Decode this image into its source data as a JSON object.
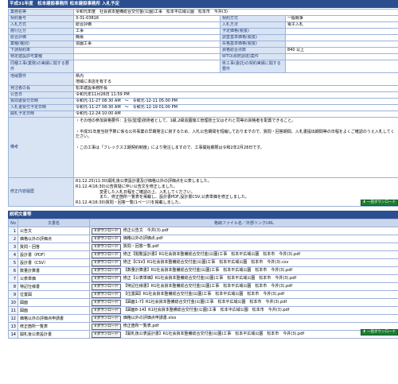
{
  "header": {
    "title": "平成31年度　松本建設事務所  松本建設事務所  入札予定"
  },
  "info": {
    "rows": [
      {
        "l1": "業務名等",
        "v1": "令和元年度　社会資本整備総合交付金(公園)工事　松本平広域公園　松本市　今井(3)",
        "span": true
      },
      {
        "l1": "契約番号",
        "v1": "3-31-03816",
        "l2": "契約方式",
        "v2": "一般競争"
      },
      {
        "l1": "入札方式",
        "v1": "総合評価",
        "l2": "入札方法",
        "v2": "電子入札"
      },
      {
        "l1": "施行区分",
        "v1": "工事",
        "l2": "予定価格(税抜)",
        "v2": ""
      },
      {
        "l1": "総合評価",
        "v1": "簡易",
        "l2": "調査基準価格(税抜)",
        "v2": ""
      },
      {
        "l1": "業種(種別)",
        "v1": "造園工事",
        "l2": "失格基準価格(税抜)",
        "v2": ""
      },
      {
        "l1": "下請契約率",
        "v1": "",
        "l2": "資格総合点数",
        "v2": "840 以上"
      },
      {
        "l1": "特定建設許可業種",
        "v1": "",
        "l2": "WTO(政府調達)案件",
        "v2": ""
      },
      {
        "l1": "同種工事(業務)の実績に関する要件",
        "v1": "",
        "l2": "県工事(委託)の契約実績に関する要件",
        "v2": "",
        "tall": true
      },
      {
        "l1": "地域要件",
        "v1": "県内\n地域に本店を有する",
        "span": true,
        "tall": true
      },
      {
        "l1": "発注者の長",
        "v1": "松本建設事務所長",
        "span": true
      },
      {
        "l1": "公告日",
        "v1": "令和元年11月26日 11:59 PM",
        "span": true
      },
      {
        "l1": "質問書受付日時",
        "v1": "令和元-11-27 08:30 AM　～　令和元-12-11 05:00 PM",
        "span": true
      },
      {
        "l1": "入札書受付予定日時",
        "v1": "令和元-11-27 08:30 AM　～　令和元-12-19 01:00 PM",
        "span": true
      },
      {
        "l1": "開札予定日時",
        "v1": "令和元-12-24 10:00 AM",
        "span": true
      }
    ],
    "remarks_label": "備考",
    "remarks": "・その他の参加資格要件：主任(監理)技術者として、1級,2級造園施工管理技士又はそれと同等の資格者を配置できること。\n\n・平成31年度当初予算に係る公共事業の早期発注に資するため、入札公告期間を短縮しておりますので、質問・回答期間、入札書提出期間等の日程をよくご確認のうえ入札してください。\n\n・この工事は「フレックス工期契約制度」により発注しますので、工事開始期限は令和2年2月28日です。",
    "history_label": "修正内容履歴",
    "history": "R1.12.25(11:30)開札後公表設計書及び価格以外の評価点を公表しました。\nR1.12.4(16:30)公告質疑に伴い公告文を修正しました。\n　　　　　　変更した入札日程をご確認の上、入札してください。\n　　　　　　また、修正箇所一覧表を掲載し、設計書PDF,設計書CSV,公表単価を修正しました。\nR1.12.4(16:30)質問・回答一覧(1ページ)を掲載しました。"
  },
  "all_download_label": "一括ダウンロード",
  "docs_section_title": "説明文書等",
  "docs": {
    "col_no": "No",
    "col_name": "文書名",
    "col_file": "格納ファイル名／外部リンクURL",
    "download_label": "ダウンロード",
    "rows": [
      {
        "no": "1",
        "name": "公告文",
        "file": "修正公告文　今井(3).pdf"
      },
      {
        "no": "2",
        "name": "価格以外の評価点",
        "file": "価格以外の評価点.pdf"
      },
      {
        "no": "3",
        "name": "質問・回答",
        "file": "質問・回答一覧.pdf"
      },
      {
        "no": "4",
        "name": "設計書（PDF）",
        "file": "修正【閲覧設計書】R1社会資本整備総合交付金(公園)工事　松本平広域公園　松本市　今井(3).pdf"
      },
      {
        "no": "5",
        "name": "設計書（CSV）",
        "file": "修正【CSV】R1社会資本整備総合交付金(公園)工事　松本平広域公園　松本市　今井(3).csv"
      },
      {
        "no": "6",
        "name": "数量計算書",
        "file": "【数量計算書】R1社会資本整備総合交付金(公園)工事　松本平広域公園　松本市　今井(3).pdf"
      },
      {
        "no": "7",
        "name": "公表単価",
        "file": "修正【公表単価】R1社会資本整備総合交付金(公園)工事　松本平広域公園　松本市　今井(3).pdf"
      },
      {
        "no": "8",
        "name": "特記仕様書",
        "file": "【特記仕様書】R1社会資本整備総合交付金(公園)工事　松本平広域公園　松本市　今井(3).pdf"
      },
      {
        "no": "9",
        "name": "位置図",
        "file": "【位置図】R1社会資本整備総合交付金(公園)工事　松本平広域公園　松本市　今井(3).pdf"
      },
      {
        "no": "10",
        "name": "図面",
        "file": "【図面1-7】R1社会資本整備総合交付金(公園)工事　松本平広域公園　松本市　今井(3).pdf"
      },
      {
        "no": "11",
        "name": "図面",
        "file": "【図面8-14】R1社会資本整備総合交付金(公園)工事　松本平広域公園　松本市　今井(3).pdf"
      },
      {
        "no": "12",
        "name": "価格以外の評価点申請書",
        "file": "価格以外の評価点申請書.xlsx"
      },
      {
        "no": "13",
        "name": "修正箇所一覧表",
        "file": "修正箇所一覧表.pdf"
      },
      {
        "no": "14",
        "name": "開札後公表設計書",
        "file": "【開札後公表設計書】R1社会資本整備総合交付金(公園)工事　松本平広域公園　松本市　今井(3).pdf"
      }
    ]
  }
}
